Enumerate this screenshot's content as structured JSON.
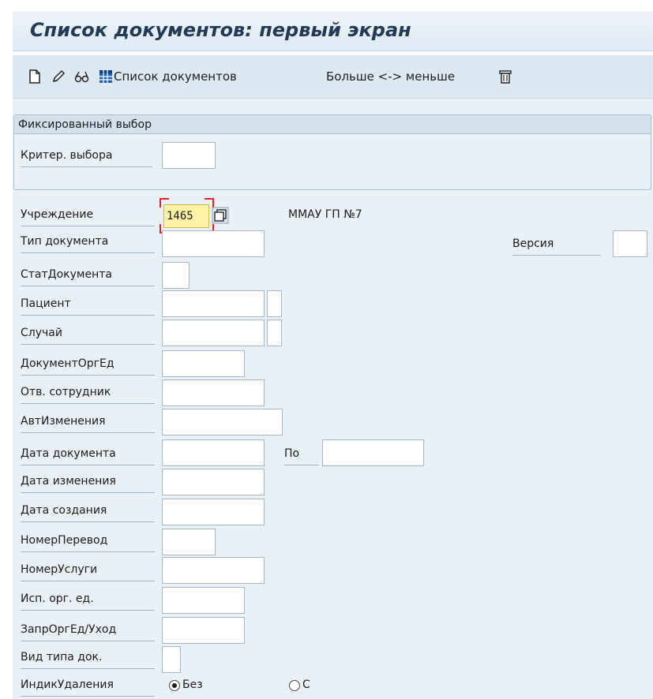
{
  "title": "Список документов: первый экран",
  "toolbar": {
    "items": [
      {
        "icon": "new-document-icon"
      },
      {
        "icon": "pencil-icon"
      },
      {
        "icon": "glasses-icon"
      },
      {
        "icon": "grid-table-icon",
        "label": "Список документов"
      },
      {
        "label": "Больше <-> меньше"
      },
      {
        "icon": "trash-icon"
      }
    ]
  },
  "fixed_selection": {
    "header": "Фиксированный выбор",
    "criteria_label": "Критер. выбора",
    "criteria_value": ""
  },
  "fields": {
    "institution": {
      "label": "Учреждение",
      "value": "1465",
      "description": "ММАУ ГП №7"
    },
    "doc_type": {
      "label": "Тип документа",
      "value": ""
    },
    "version": {
      "label": "Версия",
      "value": ""
    },
    "doc_status": {
      "label": "СтатДокумента",
      "value": ""
    },
    "patient": {
      "label": "Пациент",
      "value": ""
    },
    "case": {
      "label": "Случай",
      "value": ""
    },
    "doc_org_unit": {
      "label": "ДокументОргЕд",
      "value": ""
    },
    "responsible_employee": {
      "label": "Отв. сотрудник",
      "value": ""
    },
    "changed_by": {
      "label": "АвтИзменения",
      "value": ""
    },
    "doc_date": {
      "label": "Дата документа",
      "value": "",
      "to_label": "По",
      "to_value": ""
    },
    "change_date": {
      "label": "Дата изменения",
      "value": ""
    },
    "creation_date": {
      "label": "Дата создания",
      "value": ""
    },
    "transfer_number": {
      "label": "НомерПеревод",
      "value": ""
    },
    "service_number": {
      "label": "НомерУслуги",
      "value": ""
    },
    "exec_org_unit": {
      "label": "Исп. орг. ед.",
      "value": ""
    },
    "req_org_unit_care": {
      "label": "ЗапрОргЕд/Уход",
      "value": ""
    },
    "doc_type_kind": {
      "label": "Вид типа док.",
      "value": ""
    },
    "deletion_indicator": {
      "label": "ИндикУдаления",
      "options": [
        {
          "label": "Без",
          "selected": true
        },
        {
          "label": "С",
          "selected": false
        }
      ]
    }
  }
}
